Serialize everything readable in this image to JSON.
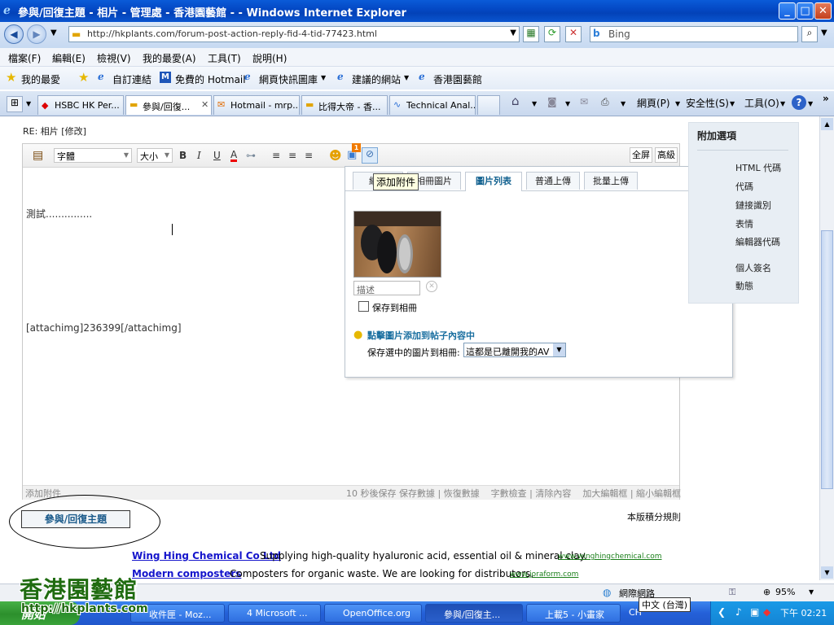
{
  "window": {
    "title": "參與/回復主題 - 相片 - 管理處 - 香港園藝館 - - Windows Internet Explorer",
    "min": "_",
    "max": "□",
    "close": "✕"
  },
  "address_bar": {
    "url": "http://hkplants.com/forum-post-action-reply-fid-4-tid-77423.html",
    "search_placeholder": "Bing"
  },
  "menu": [
    "檔案(F)",
    "編輯(E)",
    "檢視(V)",
    "我的最愛(A)",
    "工具(T)",
    "說明(H)"
  ],
  "favorites_bar": {
    "label": "我的最愛",
    "items": [
      "自訂連結",
      "免費的 Hotmail",
      "網頁快訊圖庫",
      "建議的網站",
      "香港園藝館"
    ]
  },
  "tabs": [
    "HSBC HK Per...",
    "參與/回復...",
    "Hotmail - mrp...",
    "比得大帝 - 香...",
    "Technical Anal..."
  ],
  "command_bar": [
    "網頁(P)",
    "安全性(S)",
    "工具(O)"
  ],
  "page": {
    "post_title": "RE: 相片 [修改]",
    "toolbar": {
      "font": "字體",
      "size": "大小",
      "bold": "B",
      "italic": "I",
      "underline": "U",
      "color": "A",
      "fullscreen": "全屏",
      "advanced": "高級",
      "tooltip": "添加附件",
      "attach_badge": "1"
    },
    "editor_lines": [
      "測試...............",
      "",
      "[attachimg]236399[/attachimg]"
    ],
    "popup": {
      "tabs": [
        "網絡",
        "相冊圖片",
        "圖片列表",
        "普通上傳",
        "批量上傳"
      ],
      "description_placeholder": "描述",
      "save_album": "保存到相冊",
      "hint": "點擊圖片添加到帖子內容中",
      "save_selected_label": "保存選中的圖片到相冊:",
      "album_option": "這都是已離開我的AV",
      "close": "✕"
    },
    "status": {
      "left": "添加附件",
      "right": "10 秒後保存 保存數據 | 恢復數據    字數檢查 | 清除內容    加大編輯框 | 縮小編輯框"
    },
    "submit": "參與/回復主題",
    "rules": "本版積分規則",
    "sidebar": {
      "title": "附加選項",
      "items": [
        "HTML 代碼",
        "代碼",
        "鏈接識別",
        "表情",
        "編輯器代碼",
        "個人簽名",
        "動態"
      ]
    },
    "ads": [
      {
        "title": "Wing Hing Chemical Co Ltd",
        "text": "Supplying high-quality hyaluronic acid, essential oil & mineral clay.",
        "url": "www.winghingchemical.com"
      },
      {
        "title": "Modern composters",
        "text": "Composters for organic waste. We are looking for distributors.",
        "url": "www.joraform.com"
      }
    ]
  },
  "statusbar": {
    "zone": "網際網路",
    "zoom": "95%",
    "lang": "中文 (台灣)"
  },
  "watermark": {
    "name": "香港園藝館",
    "url": "http://hkplants.com"
  },
  "taskbar": {
    "start": "開始",
    "tasks": [
      "收件匣 - Moz...",
      "4 Microsoft ...",
      "OpenOffice.org",
      "參與/回復主...",
      "上載5 - 小畫家"
    ],
    "clock": "下午 02:21",
    "ch": "CH"
  }
}
